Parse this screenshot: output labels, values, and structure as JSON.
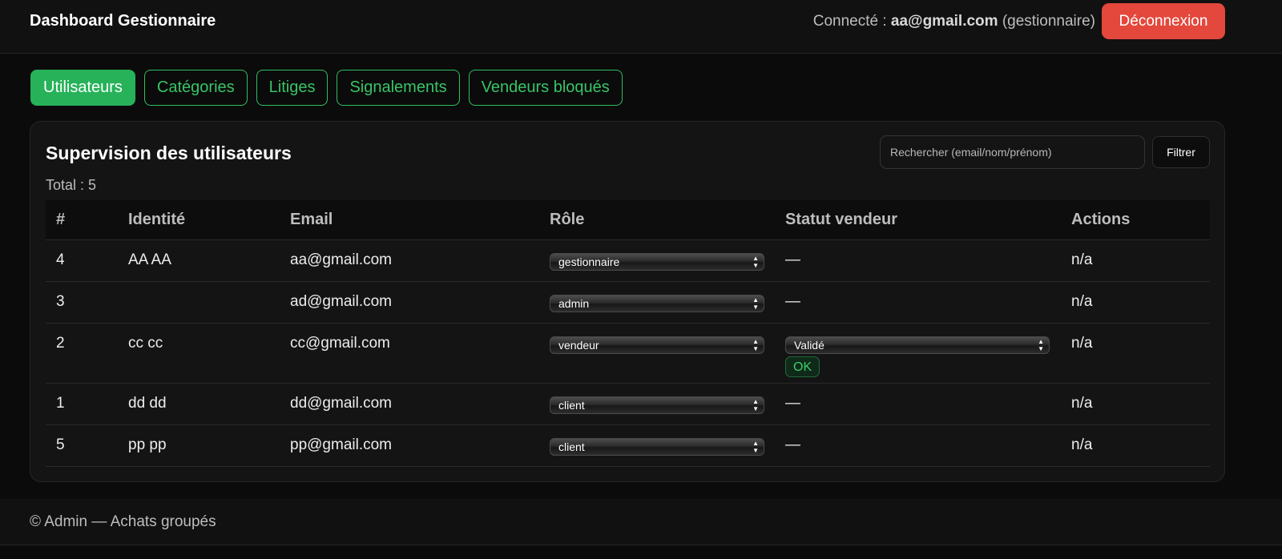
{
  "header": {
    "title": "Dashboard Gestionnaire",
    "connected_label": "Connecté :",
    "user_email": "aa@gmail.com",
    "user_role": "(gestionnaire)",
    "logout_label": "Déconnexion"
  },
  "tabs": [
    {
      "label": "Utilisateurs",
      "active": true
    },
    {
      "label": "Catégories",
      "active": false
    },
    {
      "label": "Litiges",
      "active": false
    },
    {
      "label": "Signalements",
      "active": false
    },
    {
      "label": "Vendeurs bloqués",
      "active": false
    }
  ],
  "panel": {
    "title": "Supervision des utilisateurs",
    "search_placeholder": "Rechercher (email/nom/prénom)",
    "filter_label": "Filtrer",
    "total_label": "Total : 5"
  },
  "table": {
    "columns": [
      "#",
      "Identité",
      "Email",
      "Rôle",
      "Statut vendeur",
      "Actions"
    ],
    "rows": [
      {
        "id": "4",
        "identity": "AA AA",
        "email": "aa@gmail.com",
        "role": "gestionnaire",
        "vendor_status": "—",
        "actions": "n/a"
      },
      {
        "id": "3",
        "identity": "",
        "email": "ad@gmail.com",
        "role": "admin",
        "vendor_status": "—",
        "actions": "n/a"
      },
      {
        "id": "2",
        "identity": "cc cc",
        "email": "cc@gmail.com",
        "role": "vendeur",
        "vendor_status_select": "Validé",
        "vendor_ok": "OK",
        "actions": "n/a"
      },
      {
        "id": "1",
        "identity": "dd dd",
        "email": "dd@gmail.com",
        "role": "client",
        "vendor_status": "—",
        "actions": "n/a"
      },
      {
        "id": "5",
        "identity": "pp pp",
        "email": "pp@gmail.com",
        "role": "client",
        "vendor_status": "—",
        "actions": "n/a"
      }
    ]
  },
  "footer": {
    "text": "© Admin — Achats groupés"
  },
  "colors": {
    "accent": "#27b25a",
    "danger": "#e4473c",
    "background": "#0b0b0b"
  }
}
